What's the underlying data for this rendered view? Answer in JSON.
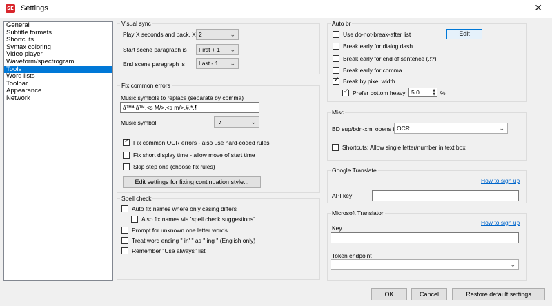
{
  "window": {
    "title": "Settings",
    "app_icon": "SE",
    "close_glyph": "✕"
  },
  "sidebar": {
    "items": [
      "General",
      "Subtitle formats",
      "Shortcuts",
      "Syntax coloring",
      "Video player",
      "Waveform/spectrogram",
      "Tools",
      "Word lists",
      "Toolbar",
      "Appearance",
      "Network"
    ],
    "selected": "Tools"
  },
  "visual_sync": {
    "title": "Visual sync",
    "play_label": "Play X seconds and back, X is",
    "play_value": "2",
    "start_label": "Start scene paragraph is",
    "start_value": "First + 1",
    "end_label": "End scene paragraph is",
    "end_value": "Last - 1"
  },
  "fix_errors": {
    "title": "Fix common errors",
    "music_replace_label": "Music symbols to replace (separate by comma)",
    "music_replace_value": "â™ª,â™,<s M/>,<s m/>,#,*,¶",
    "music_symbol_label": "Music symbol",
    "music_symbol_value": "♪",
    "ocr_label": "Fix common OCR errors - also use hard-coded rules",
    "short_display_label": "Fix short display time - allow move of start time",
    "skip_step_label": "Skip step one (choose fix rules)",
    "continuation_button": "Edit settings for fixing continuation style..."
  },
  "spell_check": {
    "title": "Spell check",
    "auto_fix_label": "Auto fix names where only casing differs",
    "also_fix_label": "Also fix names via 'spell check suggestions'",
    "prompt_label": "Prompt for unknown one letter words",
    "treat_label": "Treat word ending \" in' \" as \" ing \" (English only)",
    "remember_label": "Remember \"Use always\" list"
  },
  "auto_br": {
    "title": "Auto br",
    "dnb_label": "Use do-not-break-after list",
    "edit_button": "Edit",
    "dialog_dash_label": "Break early for dialog dash",
    "end_sentence_label": "Break early for end of sentence (.!?)",
    "comma_label": "Break early for comma",
    "pixel_width_label": "Break by pixel width",
    "bottom_heavy_label": "Prefer bottom heavy",
    "bottom_heavy_value": "5.0",
    "percent": "%"
  },
  "misc": {
    "title": "Misc",
    "bd_label": "BD sup/bdn-xml opens in",
    "bd_value": "OCR",
    "shortcuts_label": "Shortcuts: Allow single letter/number in text box"
  },
  "google": {
    "title": "Google Translate",
    "signup_link": "How to sign up",
    "api_key_label": "API key",
    "api_key_value": ""
  },
  "microsoft": {
    "title": "Microsoft Translator",
    "signup_link": "How to sign up",
    "key_label": "Key",
    "key_value": "",
    "token_label": "Token endpoint",
    "token_value": ""
  },
  "footer": {
    "ok": "OK",
    "cancel": "Cancel",
    "restore": "Restore default settings"
  },
  "colors": {
    "selection": "#0078d7",
    "link": "#0066cc",
    "app_icon": "#d9262c"
  }
}
